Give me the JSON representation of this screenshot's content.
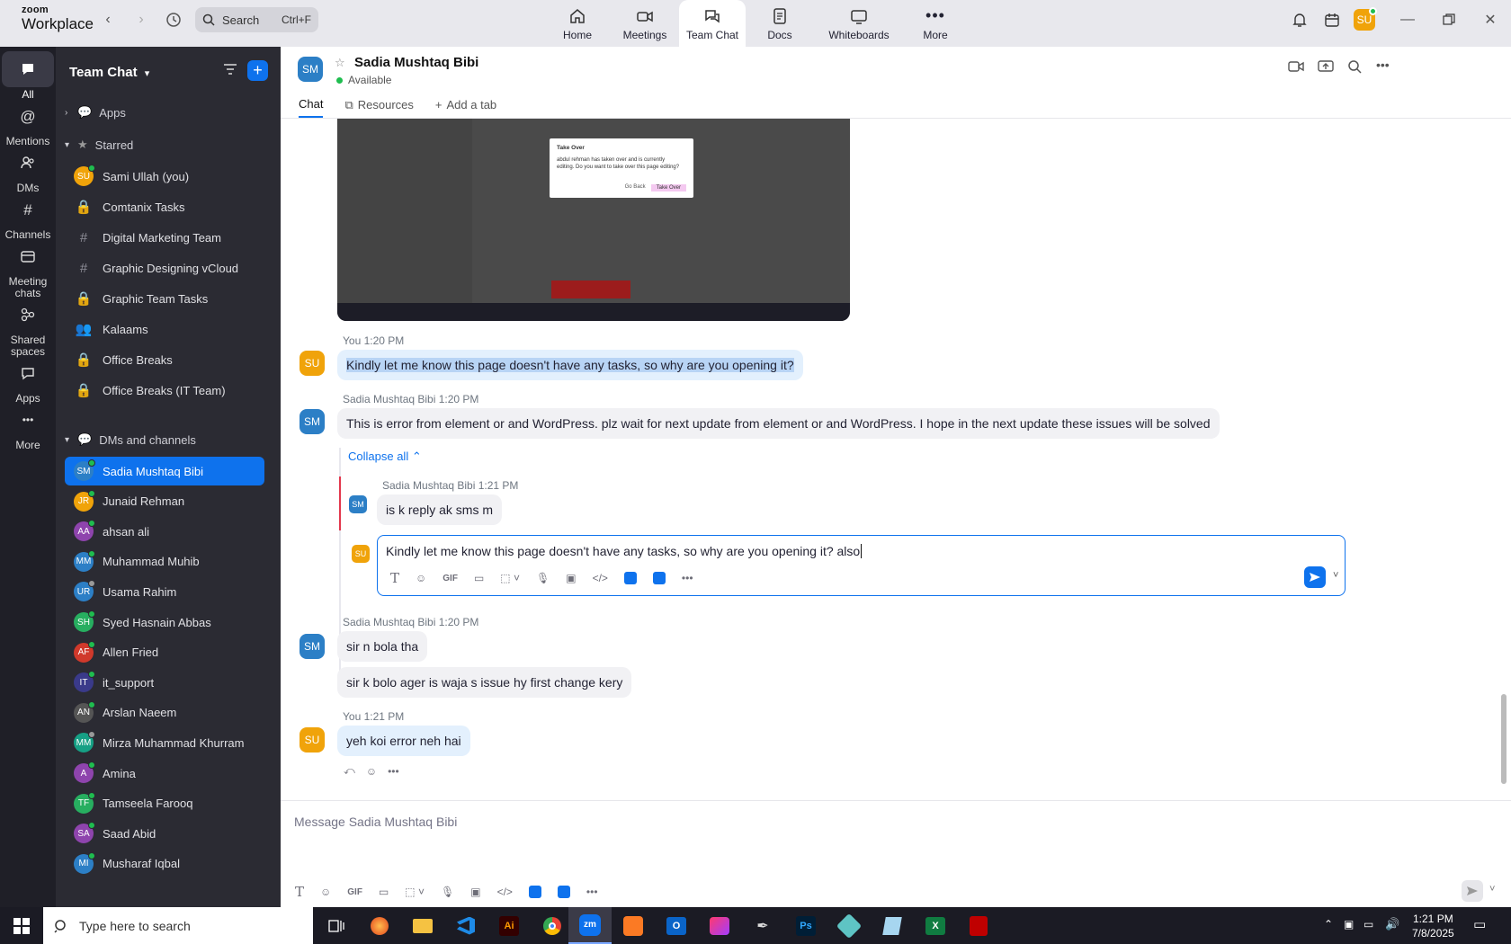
{
  "app": {
    "brand_top": "zoom",
    "brand_bottom": "Workplace"
  },
  "search": {
    "label": "Search",
    "shortcut": "Ctrl+F"
  },
  "nav_tabs": [
    {
      "label": "Home",
      "icon": "home-icon"
    },
    {
      "label": "Meetings",
      "icon": "video-icon"
    },
    {
      "label": "Team Chat",
      "icon": "chat-icon"
    },
    {
      "label": "Docs",
      "icon": "doc-icon"
    },
    {
      "label": "Whiteboards",
      "icon": "whiteboard-icon"
    },
    {
      "label": "More",
      "icon": "more-icon"
    }
  ],
  "user": {
    "initials": "SU",
    "color": "#f0a30a"
  },
  "rail": [
    {
      "label": "All",
      "icon": "chat-bubble-icon"
    },
    {
      "label": "Mentions",
      "icon": "at-icon"
    },
    {
      "label": "DMs",
      "icon": "people-icon"
    },
    {
      "label": "Channels",
      "icon": "hash-icon"
    },
    {
      "label": "Meeting chats",
      "icon": "calendar-icon"
    },
    {
      "label": "Shared spaces",
      "icon": "share-icon"
    },
    {
      "label": "Apps",
      "icon": "apps-icon"
    },
    {
      "label": "More",
      "icon": "more-icon"
    }
  ],
  "sidebar": {
    "title": "Team Chat",
    "apps_label": "Apps",
    "starred_label": "Starred",
    "dms_label": "DMs and channels",
    "starred": [
      {
        "label": "Sami Ullah (you)",
        "type": "avatar",
        "initials": "SU",
        "color": "#f0a30a"
      },
      {
        "label": "Comtanix Tasks",
        "type": "lock"
      },
      {
        "label": "Digital Marketing Team",
        "type": "hash"
      },
      {
        "label": "Graphic Designing vCloud",
        "type": "hash"
      },
      {
        "label": "Graphic Team Tasks",
        "type": "lock"
      },
      {
        "label": "Kalaams",
        "type": "group"
      },
      {
        "label": "Office Breaks",
        "type": "lock"
      },
      {
        "label": "Office Breaks (IT Team)",
        "type": "lock"
      }
    ],
    "dms": [
      {
        "label": "Sadia Mushtaq Bibi",
        "initials": "SM",
        "color": "#2c7fc6"
      },
      {
        "label": "Junaid Rehman",
        "initials": "JR",
        "color": "#f0a30a"
      },
      {
        "label": "ahsan ali",
        "initials": "AA",
        "color": "#8e44ad"
      },
      {
        "label": "Muhammad Muhib",
        "initials": "MM",
        "color": "#2c7fc6"
      },
      {
        "label": "Usama Rahim",
        "initials": "UR",
        "color": "#2c7fc6"
      },
      {
        "label": "Syed Hasnain Abbas",
        "initials": "SH",
        "color": "#27ae60"
      },
      {
        "label": "Allen Fried",
        "initials": "AF",
        "color": "#d0392b"
      },
      {
        "label": "it_support",
        "initials": "IT",
        "color": "#3a3a8a"
      },
      {
        "label": "Arslan Naeem",
        "initials": "AN",
        "color": "#555"
      },
      {
        "label": "Mirza Muhammad Khurram",
        "initials": "MM",
        "color": "#16a085"
      },
      {
        "label": "Amina",
        "initials": "A",
        "color": "#8e44ad"
      },
      {
        "label": "Tamseela Farooq",
        "initials": "TF",
        "color": "#27ae60"
      },
      {
        "label": "Saad Abid",
        "initials": "SA",
        "color": "#8e44ad"
      },
      {
        "label": "Musharaf Iqbal",
        "initials": "MI",
        "color": "#2c7fc6"
      }
    ]
  },
  "chat": {
    "contact_name": "Sadia Mushtaq Bibi",
    "contact_initials": "SM",
    "status": "Available",
    "tabs": [
      "Chat",
      "Resources",
      "Add a tab"
    ],
    "messages": {
      "m1_meta": "You 1:20 PM",
      "m1_text": "Kindly let me know this page doesn't have any tasks, so why are you opening it?",
      "m2_meta": "Sadia Mushtaq Bibi 1:20 PM",
      "m2_text": "This is error from element or and WordPress. plz wait for next update from element or and WordPress. I hope in the next update these issues will be solved",
      "collapse": "Collapse all",
      "r1_meta": "Sadia Mushtaq Bibi 1:21 PM",
      "r1_text": "is k reply ak sms m",
      "reply_draft": "Kindly let me know this page doesn't have any tasks, so why are you opening it? also",
      "m3_meta": "Sadia Mushtaq Bibi 1:20 PM",
      "m3_text1": "sir n bola tha",
      "m3_text2": "sir k bolo ager is waja s issue hy first change kery",
      "m4_meta": "You 1:21 PM",
      "m4_text": "yeh koi error neh hai"
    },
    "screenshot": {
      "dialog_title": "Take Over",
      "dialog_body": "abdul rehman has taken over and is currently editing. Do you want to take over this page editing?",
      "btn_no": "Go Back",
      "btn_yes": "Take Over"
    },
    "composer_placeholder": "Message Sadia Mushtaq Bibi"
  },
  "taskbar": {
    "search_placeholder": "Type here to search",
    "time": "1:21 PM",
    "date": "7/8/2025"
  }
}
